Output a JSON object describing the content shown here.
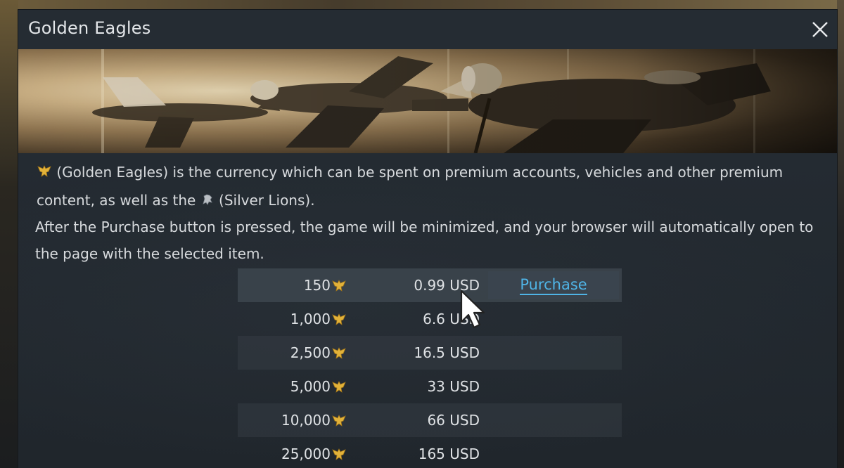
{
  "window": {
    "title": "Golden Eagles",
    "close_icon": "close-icon"
  },
  "info": {
    "p1_part1": "(Golden Eagles) is the currency which can be spent on premium accounts, vehicles and other premium content, as well as the",
    "p1_part2": "(Silver Lions).",
    "p2": "After the Purchase button is pressed, the game will be minimized, and your browser will automatically open to the page with the selected item."
  },
  "currency_icons": {
    "golden_eagle": "golden-eagle-icon",
    "silver_lion": "silver-lion-icon"
  },
  "offers": [
    {
      "amount": "150",
      "price": "0.99 USD"
    },
    {
      "amount": "1,000",
      "price": "6.6 USD"
    },
    {
      "amount": "2,500",
      "price": "16.5 USD"
    },
    {
      "amount": "5,000",
      "price": "33 USD"
    },
    {
      "amount": "10,000",
      "price": "66 USD"
    },
    {
      "amount": "25,000",
      "price": "165 USD"
    }
  ],
  "purchase_label": "Purchase",
  "colors": {
    "accent_link": "#4fb4e6",
    "eagle_gold": "#e2b23a",
    "text": "#d7dadd"
  }
}
